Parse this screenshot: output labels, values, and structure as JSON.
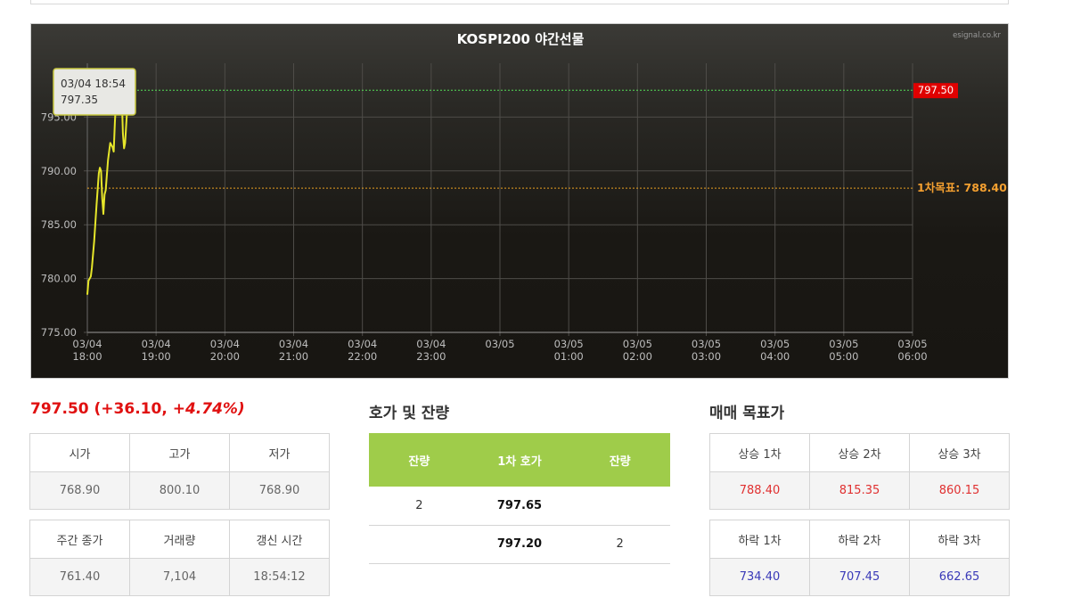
{
  "chart_data": {
    "type": "line",
    "title": "KOSPI200 야간선물",
    "watermark": "esignal.co.kr",
    "ylim": [
      775,
      800
    ],
    "y_ticks": [
      "775.00",
      "780.00",
      "785.00",
      "790.00",
      "795.00"
    ],
    "x_ticks": [
      {
        "date": "03/04",
        "time": "18:00"
      },
      {
        "date": "03/04",
        "time": "19:00"
      },
      {
        "date": "03/04",
        "time": "20:00"
      },
      {
        "date": "03/04",
        "time": "21:00"
      },
      {
        "date": "03/04",
        "time": "22:00"
      },
      {
        "date": "03/04",
        "time": "23:00"
      },
      {
        "date": "03/05",
        "time": ""
      },
      {
        "date": "03/05",
        "time": "01:00"
      },
      {
        "date": "03/05",
        "time": "02:00"
      },
      {
        "date": "03/05",
        "time": "03:00"
      },
      {
        "date": "03/05",
        "time": "04:00"
      },
      {
        "date": "03/05",
        "time": "05:00"
      },
      {
        "date": "03/05",
        "time": "06:00"
      }
    ],
    "series": [
      {
        "color": "#e6e62a",
        "points": [
          [
            "03/04 18:00",
            778.5
          ],
          [
            "03/04 18:01",
            779.8
          ],
          [
            "03/04 18:03",
            780.2
          ],
          [
            "03/04 18:04",
            781.0
          ],
          [
            "03/04 18:06",
            783.5
          ],
          [
            "03/04 18:08",
            786.8
          ],
          [
            "03/04 18:10",
            789.8
          ],
          [
            "03/04 18:11",
            790.3
          ],
          [
            "03/04 18:12",
            790.0
          ],
          [
            "03/04 18:13",
            787.5
          ],
          [
            "03/04 18:14",
            786.0
          ],
          [
            "03/04 18:15",
            787.8
          ],
          [
            "03/04 18:16",
            788.2
          ],
          [
            "03/04 18:18",
            791.0
          ],
          [
            "03/04 18:20",
            792.6
          ],
          [
            "03/04 18:22",
            792.2
          ],
          [
            "03/04 18:23",
            791.8
          ],
          [
            "03/04 18:24",
            794.5
          ],
          [
            "03/04 18:25",
            796.5
          ],
          [
            "03/04 18:27",
            797.4
          ],
          [
            "03/04 18:29",
            797.8
          ],
          [
            "03/04 18:30",
            797.0
          ],
          [
            "03/04 18:31",
            793.5
          ],
          [
            "03/04 18:32",
            792.1
          ],
          [
            "03/04 18:33",
            792.6
          ],
          [
            "03/04 18:35",
            796.2
          ],
          [
            "03/04 18:36",
            796.7
          ],
          [
            "03/04 18:38",
            796.5
          ],
          [
            "03/04 18:40",
            797.1
          ],
          [
            "03/04 18:41",
            797.5
          ]
        ]
      }
    ],
    "current_line": {
      "value": 797.5,
      "label": "797.50",
      "color": "#55dd55",
      "badge_color": "#e00000"
    },
    "target_line": {
      "value": 788.4,
      "label": "1차목표: 788.40",
      "color": "#e8a020"
    },
    "tooltip": {
      "time": "03/04 18:54",
      "value": "797.35"
    },
    "grid": true
  },
  "summary": {
    "price": "797.50",
    "change": "(+36.10,",
    "change_pct": "+4.74%)"
  },
  "quote_table1": {
    "headers": [
      "시가",
      "고가",
      "저가"
    ],
    "values": [
      "768.90",
      "800.10",
      "768.90"
    ]
  },
  "quote_table2": {
    "headers": [
      "주간 종가",
      "거래량",
      "갱신 시간"
    ],
    "values": [
      "761.40",
      "7,104",
      "18:54:12"
    ]
  },
  "hoga": {
    "title": "호가 및 잔량",
    "headers": [
      "잔량",
      "1차 호가",
      "잔량"
    ],
    "rows": [
      [
        "2",
        "797.65",
        ""
      ],
      [
        "",
        "797.20",
        "2"
      ]
    ]
  },
  "targets": {
    "title": "매매 목표가",
    "up_headers": [
      "상승 1차",
      "상승 2차",
      "상승 3차"
    ],
    "up_values": [
      "788.40",
      "815.35",
      "860.15"
    ],
    "down_headers": [
      "하락 1차",
      "하락 2차",
      "하락 3차"
    ],
    "down_values": [
      "734.40",
      "707.45",
      "662.65"
    ]
  }
}
